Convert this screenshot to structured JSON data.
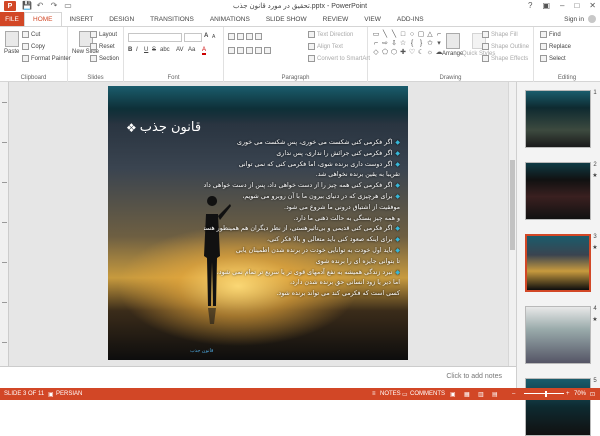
{
  "window": {
    "title": "تحقیق در مورد قانون جذب.pptx - PowerPoint",
    "controls": {
      "help": "?",
      "ribbon": "▣",
      "minimize": "–",
      "maximize": "□",
      "close": "✕"
    }
  },
  "quick_access": {
    "save": "💾",
    "undo": "↶",
    "redo": "↷",
    "present": "▭"
  },
  "tabs": [
    "FILE",
    "HOME",
    "INSERT",
    "DESIGN",
    "TRANSITIONS",
    "ANIMATIONS",
    "SLIDE SHOW",
    "REVIEW",
    "VIEW",
    "ADD-INS"
  ],
  "active_tab": "HOME",
  "signin": "Sign in",
  "ribbon": {
    "clipboard": {
      "paste": "Paste",
      "cut": "Cut",
      "copy": "Copy",
      "format_painter": "Format Painter",
      "label": "Clipboard"
    },
    "slides": {
      "new_slide": "New Slide",
      "layout": "Layout",
      "reset": "Reset",
      "section": "Section",
      "label": "Slides"
    },
    "font": {
      "label": "Font",
      "bold": "B",
      "italic": "I",
      "underline": "U",
      "strike": "S",
      "shadow": "abc",
      "spacing": "AV",
      "case": "Aa",
      "grow": "A",
      "shrink": "A",
      "color": "A"
    },
    "paragraph": {
      "text_direction": "Text Direction",
      "align_text": "Align Text",
      "smartart": "Convert to SmartArt",
      "label": "Paragraph"
    },
    "drawing": {
      "arrange": "Arrange",
      "quick_styles": "Quick Styles",
      "shape_fill": "Shape Fill",
      "shape_outline": "Shape Outline",
      "shape_effects": "Shape Effects",
      "label": "Drawing"
    },
    "editing": {
      "find": "Find",
      "replace": "Replace",
      "select": "Select",
      "label": "Editing"
    }
  },
  "slide": {
    "title": "قانون جذب",
    "lines": [
      {
        "text": "اگر فکرمی کنی شکست می خوری، پس شکست می خوری",
        "bullet": true
      },
      {
        "text": "اگر فکرمی کنی جرائش را نداری، پس نداری",
        "bullet": true
      },
      {
        "text": "اگر دوست داری برنده شوی، اما فکرمی کنی که نمی توانی",
        "bullet": true
      },
      {
        "text": "تقریبا به یقین برنده نخواهی شد.",
        "bullet": false
      },
      {
        "text": "اگر فکرمی کنی همه چیز را از دست خواهی داد، پس از دست خواهی داد",
        "bullet": true
      },
      {
        "text": "برای هرچیزی که در دنیای بیرون ما با آن روبرو می شویم،",
        "bullet": true
      },
      {
        "text": "موفقیت از اشتیاق درونی ما شروع می شود.",
        "bullet": false
      },
      {
        "text": "و همه چیز بستگی به حالت ذهنی ما دارد.",
        "bullet": false
      },
      {
        "text": "اگر فکرمی کنی قدیمی و بی‌تاثیرهستی، از نظر دیگران هم همینطور هستی",
        "bullet": true
      },
      {
        "text": "برای اینکه صعود کنی باید متعالی و بالا فکر کنی،",
        "bullet": true
      },
      {
        "text": "باید اول خودت به توانایی خودت در برنده شدن اطمینان یابی",
        "bullet": true
      },
      {
        "text": "تا بتوانی جایزه ای را برنده شوی",
        "bullet": false
      },
      {
        "text": "نبرد زندگی همیشه به نفع آدمهای قوی تر یا سریع تر تمام نمی شود،",
        "bullet": true
      },
      {
        "text": "اما دیر یا زود انسانی حق برنده شدن دارد،",
        "bullet": false
      },
      {
        "text": "کسی است که فکرمی کند می تواند برنده شود.",
        "bullet": false
      }
    ],
    "footer": "قانون جذب"
  },
  "notes_placeholder": "Click to add notes",
  "thumbnails": [
    {
      "num": "1",
      "star": "",
      "selected": false
    },
    {
      "num": "2",
      "star": "★",
      "selected": false
    },
    {
      "num": "3",
      "star": "★",
      "selected": true
    },
    {
      "num": "4",
      "star": "★",
      "selected": false
    },
    {
      "num": "5",
      "star": "",
      "selected": false
    }
  ],
  "status": {
    "slide_info": "SLIDE 3 OF 11",
    "language": "PERSIAN",
    "notes": "NOTES",
    "comments": "COMMENTS",
    "zoom": "70%"
  },
  "colors": {
    "accent": "#d24726",
    "bullet": "#37b7d8"
  }
}
